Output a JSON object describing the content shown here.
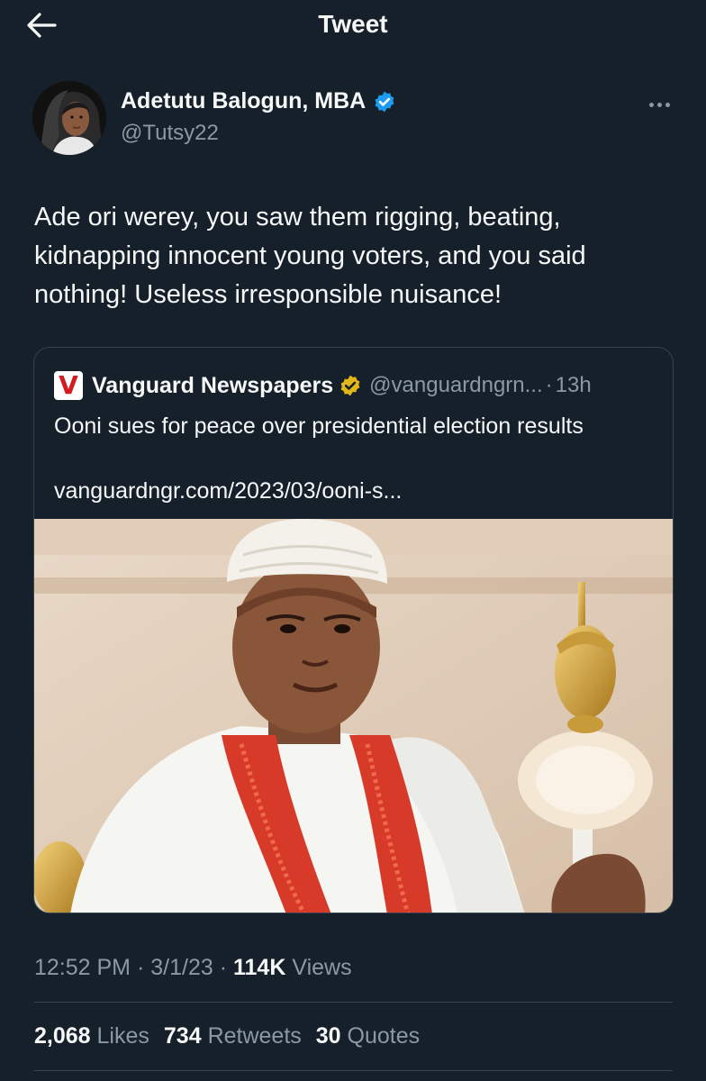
{
  "header": {
    "title": "Tweet",
    "back_icon": "arrow-left-icon"
  },
  "author": {
    "name": "Adetutu Balogun, MBA",
    "handle": "@Tutsy22",
    "verified_icon": "verified-badge-icon",
    "verified_color": "#1d9bf0"
  },
  "tweet": {
    "text": "Ade ori werey, you saw them rigging, beating, kidnapping innocent young voters, and you said nothing! Useless irresponsible nuisance!"
  },
  "quote": {
    "logo_letter": "V",
    "name": "Vanguard Newspapers",
    "verified_color": "#e2b719",
    "handle": "@vanguardngrn...",
    "separator": "·",
    "time": "13h",
    "title": "Ooni sues for peace over presidential election results",
    "link": "vanguardngr.com/2023/03/ooni-s...",
    "image_subject": "man-in-white-beaded-crown-holding-golden-staff"
  },
  "meta": {
    "time": "12:52 PM",
    "sep": "·",
    "date": "3/1/23",
    "views_count": "114K",
    "views_label": "Views"
  },
  "stats": {
    "likes_count": "2,068",
    "likes_label": "Likes",
    "retweets_count": "734",
    "retweets_label": "Retweets",
    "quotes_count": "30",
    "quotes_label": "Quotes"
  },
  "colors": {
    "background": "#15202b",
    "text": "#f7f9f9",
    "muted": "#8b98a5",
    "border": "#38444d"
  }
}
